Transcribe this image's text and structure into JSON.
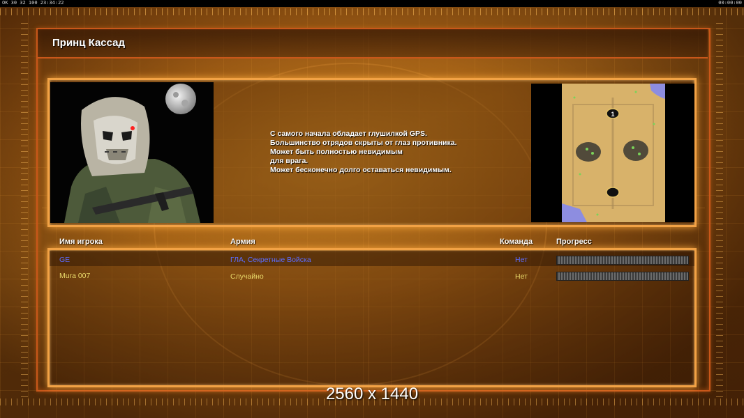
{
  "status_bar": {
    "left_text": "ОК 30 32 100 23:34:22",
    "right_text": "00:00:00"
  },
  "title": "Принц Кассад",
  "portrait": {
    "icon": "soldier-portrait"
  },
  "description": {
    "lines": [
      "С самого начала обладает глушилкой GPS.",
      "Большинство отрядов скрыты от глаз противника.",
      "Может быть полностью невидимым",
      "для врага.",
      "Может бесконечно долго оставаться невидимым."
    ]
  },
  "minimap": {
    "icon": "desert-minimap",
    "start_positions": [
      "1",
      ""
    ]
  },
  "columns": {
    "player_name": "Имя игрока",
    "army": "Армия",
    "team": "Команда",
    "progress": "Прогресс"
  },
  "players": [
    {
      "name": "GE",
      "army": "ГЛА, Секретные Войска",
      "team": "Нет",
      "progress": 0,
      "color": "#5b6cff"
    },
    {
      "name": "Mura 007",
      "army": "Случайно",
      "team": "Нет",
      "progress": 0,
      "color": "#e9d96a"
    }
  ],
  "resolution": "2560 x 1440"
}
